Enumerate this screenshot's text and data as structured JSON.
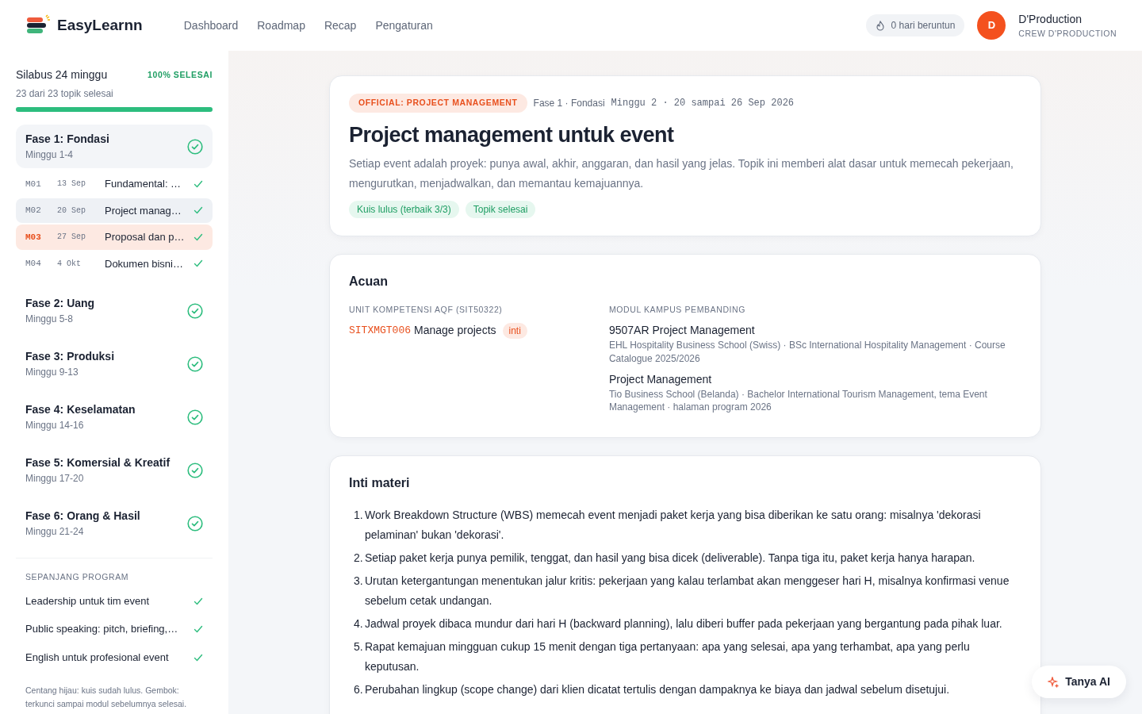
{
  "header": {
    "brand": "EasyLearnn",
    "nav": [
      {
        "label": "Dashboard",
        "selected": false
      },
      {
        "label": "Roadmap",
        "selected": false
      },
      {
        "label": "Recap",
        "selected": false
      },
      {
        "label": "Pengaturan",
        "selected": false
      }
    ],
    "streak": "0 hari beruntun",
    "user": {
      "initial": "D",
      "name": "D'Production",
      "role": "CREW D'PRODUCTION"
    }
  },
  "sidebar": {
    "title": "Silabus 24 minggu",
    "percent": "100% SELESAI",
    "summary": "23 dari 23 topik selesai",
    "level": 1,
    "phases": [
      {
        "title": "Fase 1: Fondasi",
        "weeks": "Minggu 1-4",
        "done": true,
        "expanded": true,
        "modules": [
          {
            "code": "M01",
            "date": "13 Sep",
            "title": "Fundamental: …",
            "done": true,
            "selected": false,
            "current": false
          },
          {
            "code": "M02",
            "date": "20 Sep",
            "title": "Project manag…",
            "done": true,
            "selected": true,
            "current": false
          },
          {
            "code": "M03",
            "date": "27 Sep",
            "title": "Proposal dan p…",
            "done": true,
            "selected": false,
            "current": true
          },
          {
            "code": "M04",
            "date": "4 Okt",
            "title": "Dokumen bisni…",
            "done": true,
            "selected": false,
            "current": false
          }
        ]
      },
      {
        "title": "Fase 2: Uang",
        "weeks": "Minggu 5-8",
        "done": true,
        "expanded": false
      },
      {
        "title": "Fase 3: Produksi",
        "weeks": "Minggu 9-13",
        "done": true,
        "expanded": false
      },
      {
        "title": "Fase 4: Keselamatan",
        "weeks": "Minggu 14-16",
        "done": true,
        "expanded": false
      },
      {
        "title": "Fase 5: Komersial & Kreatif",
        "weeks": "Minggu 17-20",
        "done": true,
        "expanded": false
      },
      {
        "title": "Fase 6: Orang & Hasil",
        "weeks": "Minggu 21-24",
        "done": true,
        "expanded": false
      }
    ],
    "program_heading": "SEPANJANG PROGRAM",
    "program": [
      {
        "title": "Leadership untuk tim event",
        "done": true
      },
      {
        "title": "Public speaking: pitch, briefing,…",
        "done": true
      },
      {
        "title": "English untuk profesional event",
        "done": true
      }
    ],
    "note": "Centang hijau: kuis sudah lulus. Gembok: terkunci sampai modul sebelumnya selesai."
  },
  "topic": {
    "tag": "OFFICIAL: PROJECT MANAGEMENT",
    "phase": "Fase 1 · Fondasi",
    "week": "Minggu 2 · 20 sampai 26 Sep 2026",
    "title": "Project management untuk event",
    "intro": "Setiap event adalah proyek: punya awal, akhir, anggaran, dan hasil yang jelas. Topik ini memberi alat dasar untuk memecah pekerjaan, mengurutkan, menjadwalkan, dan memantau kemajuannya.",
    "badges": [
      "Kuis lulus (terbaik 3/3)",
      "Topik selesai"
    ]
  },
  "reference": {
    "title": "Acuan",
    "unit_heading": "UNIT KOMPETENSI AQF (SIT50322)",
    "unit": {
      "code": "SITXMGT006",
      "name": "Manage projects",
      "badge": "inti"
    },
    "campus_heading": "MODUL KAMPUS PEMBANDING",
    "campus": [
      {
        "name": "9507AR Project Management",
        "source": "EHL Hospitality Business School (Swiss) · BSc International Hospitality Management · Course Catalogue 2025/2026"
      },
      {
        "name": "Project Management",
        "source": "Tio Business School (Belanda) · Bachelor International Tourism Management, tema Event Management · halaman program 2026"
      }
    ]
  },
  "core": {
    "title": "Inti materi",
    "numbers": [
      "1.",
      "2.",
      "3.",
      "4.",
      "5.",
      "6."
    ],
    "points": [
      "Work Breakdown Structure (WBS) memecah event menjadi paket kerja yang bisa diberikan ke satu orang: misalnya 'dekorasi pelaminan' bukan 'dekorasi'.",
      "Setiap paket kerja punya pemilik, tenggat, dan hasil yang bisa dicek (deliverable). Tanpa tiga itu, paket kerja hanya harapan.",
      "Urutan ketergantungan menentukan jalur kritis: pekerjaan yang kalau terlambat akan menggeser hari H, misalnya konfirmasi venue sebelum cetak undangan.",
      "Jadwal proyek dibaca mundur dari hari H (backward planning), lalu diberi buffer pada pekerjaan yang bergantung pada pihak luar.",
      "Rapat kemajuan mingguan cukup 15 menit dengan tiga pertanyaan: apa yang selesai, apa yang terhambat, apa yang perlu keputusan.",
      "Perubahan lingkup (scope change) dari klien dicatat tertulis dengan dampaknya ke biaya dan jadwal sebelum disetujui."
    ]
  },
  "assistant": {
    "label": "Tanya AI"
  }
}
